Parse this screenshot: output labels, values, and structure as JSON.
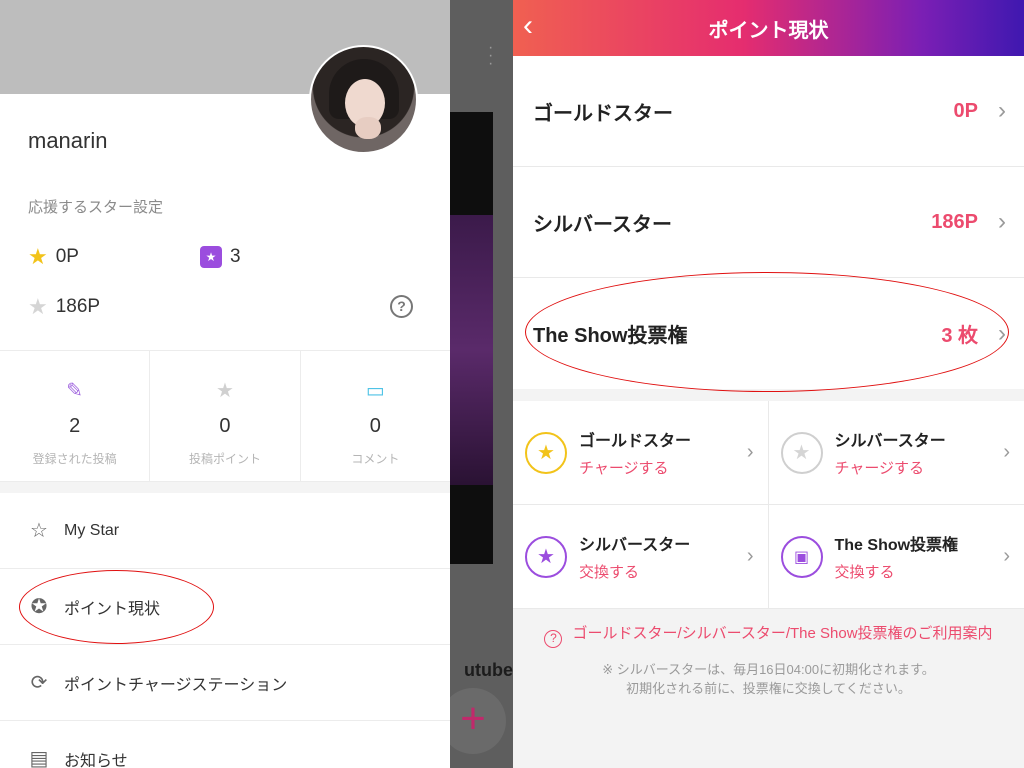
{
  "left": {
    "username": "manarin",
    "star_setting_label": "応援するスター設定",
    "gold_points": "0P",
    "tickets": "3",
    "silver_points": "186P",
    "help_icon": "question-circle-icon",
    "counts": [
      {
        "icon": "pencil-icon",
        "value": "2",
        "label": "登録された投稿"
      },
      {
        "icon": "star-icon",
        "value": "0",
        "label": "投稿ポイント"
      },
      {
        "icon": "comment-icon",
        "value": "0",
        "label": "コメント"
      }
    ],
    "menu": [
      {
        "icon": "star-outline-icon",
        "label": "My Star"
      },
      {
        "icon": "point-status-icon",
        "label": "ポイント現状"
      },
      {
        "icon": "charge-station-icon",
        "label": "ポイントチャージステーション"
      },
      {
        "icon": "notice-icon",
        "label": "お知らせ"
      }
    ]
  },
  "overlay": {
    "partial_text": "utube"
  },
  "right": {
    "header_title": "ポイント現状",
    "rows": [
      {
        "label": "ゴールドスター",
        "value": "0P"
      },
      {
        "label": "シルバースター",
        "value": "186P"
      },
      {
        "label": "The Show投票権",
        "value": "3 枚"
      }
    ],
    "grid": [
      {
        "icon": "gold-star-icon",
        "title": "ゴールドスター",
        "sub": "チャージする"
      },
      {
        "icon": "silver-star-icon",
        "title": "シルバースター",
        "sub": "チャージする"
      },
      {
        "icon": "silver-exchange-icon",
        "title": "シルバースター",
        "sub": "交換する"
      },
      {
        "icon": "ticket-exchange-icon",
        "title": "The Show投票権",
        "sub": "交換する"
      }
    ],
    "notice_link": "ゴールドスター/シルバースター/The Show投票権のご利用案内",
    "notice_note_1": "※ シルバースターは、毎月16日04:00に初期化されます。",
    "notice_note_2": "初期化される前に、投票権に交換してください。"
  },
  "colors": {
    "accent_pink": "#ec4b6e",
    "header_gradient_start": "#f06051",
    "header_gradient_end": "#3f18b0",
    "annotation_red": "#e01010"
  }
}
